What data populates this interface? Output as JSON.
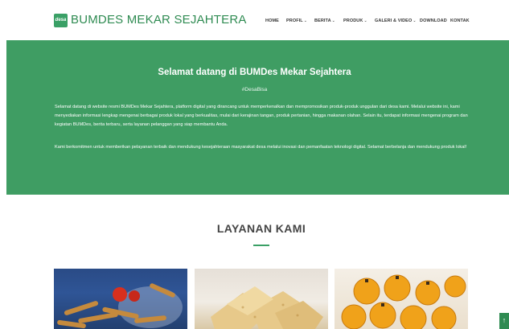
{
  "header": {
    "logo_text": "desa",
    "brand": "BUMDES MEKAR SEJAHTERA",
    "nav": [
      {
        "label": "HOME",
        "dropdown": false
      },
      {
        "label": "PROFIL",
        "dropdown": true
      },
      {
        "label": "BERITA",
        "dropdown": true
      },
      {
        "label": "PRODUK",
        "dropdown": true
      },
      {
        "label": "GALERI & VIDEO",
        "dropdown": true
      },
      {
        "label": "DOWNLOAD",
        "dropdown": false
      },
      {
        "label": "KONTAK",
        "dropdown": false
      }
    ]
  },
  "hero": {
    "title": "Selamat datang di BUMDes Mekar Sejahtera",
    "tag": "#DesaBisa",
    "paragraph1": "Selamat datang di website resmi BUMDes Mekar Sejahtera, platform digital yang dirancang untuk memperkenalkan dan mempromosikan produk-produk unggulan dari desa kami. Melalui website ini, kami menyediakan informasi lengkap mengenai berbagai produk lokal yang berkualitas, mulai dari kerajinan tangan, produk pertanian, hingga makanan olahan. Selain itu, terdapat informasi mengenai program dan kegiatan BUMDes, berita terbaru, serta layanan pelanggan yang siap membantu Anda.",
    "paragraph2": "Kami berkomitmen untuk memberikan pelayanan terbaik dan mendukung kesejahteraan masyarakat desa melalui inovasi dan pemanfaatan teknologi digital. Selamat berbelanja dan mendukung produk lokal!"
  },
  "services": {
    "title": "LAYANAN KAMI"
  },
  "colors": {
    "brand": "#3aa066",
    "hero_bg": "#3f9d63"
  },
  "icons": {
    "dropdown": "chevron-down-icon",
    "scroll_top": "arrow-up-icon"
  }
}
